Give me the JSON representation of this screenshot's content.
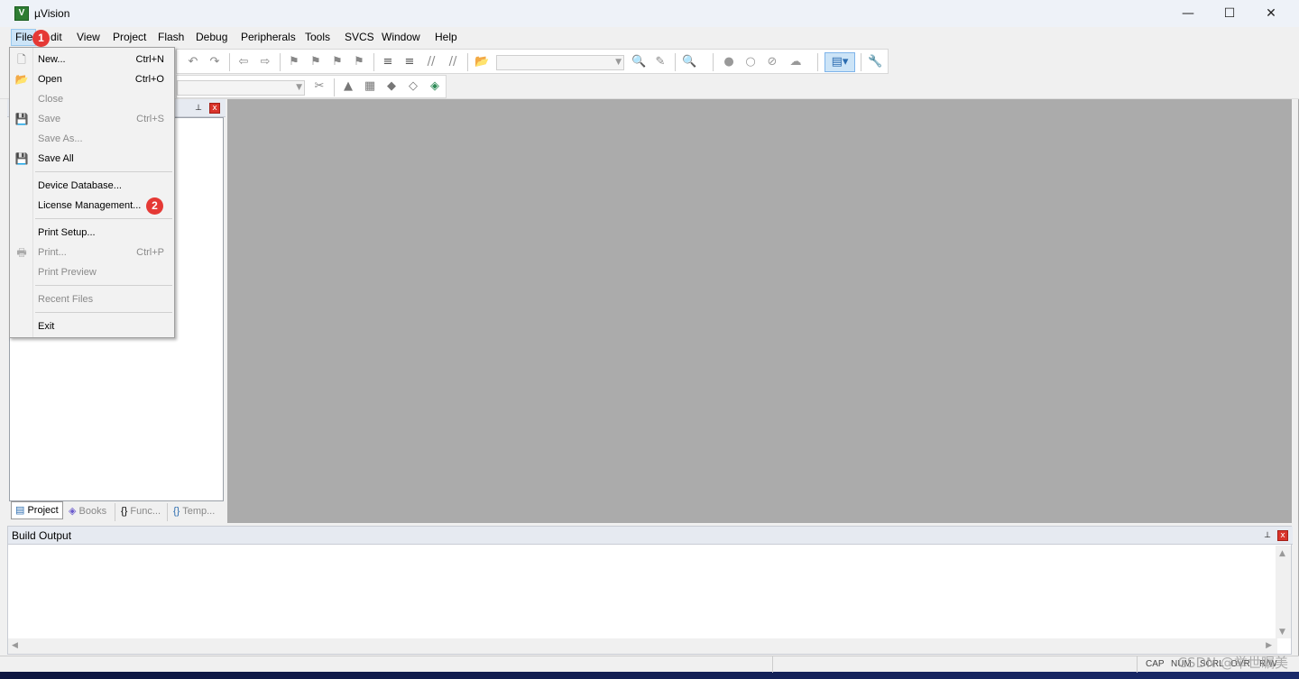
{
  "window": {
    "title": "µVision",
    "app_icon_glyph": "V",
    "controls": {
      "minimize": "—",
      "maximize": "☐",
      "close": "✕"
    }
  },
  "menubar": {
    "items": [
      "File",
      "Edit",
      "View",
      "Project",
      "Flash",
      "Debug",
      "Peripherals",
      "Tools",
      "SVCS",
      "Window",
      "Help"
    ],
    "file_menu_label": "File",
    "edit_menu_label_visible": "dit"
  },
  "annotations": {
    "badge1": "1",
    "badge2": "2"
  },
  "file_menu": {
    "new": {
      "label": "New...",
      "shortcut": "Ctrl+N",
      "enabled": true,
      "icon": "new-document-icon"
    },
    "open": {
      "label": "Open",
      "shortcut": "Ctrl+O",
      "enabled": true,
      "icon": "open-folder-icon"
    },
    "close": {
      "label": "Close",
      "shortcut": "",
      "enabled": false
    },
    "save": {
      "label": "Save",
      "shortcut": "Ctrl+S",
      "enabled": false,
      "icon": "save-icon"
    },
    "save_as": {
      "label": "Save As...",
      "shortcut": "",
      "enabled": false
    },
    "save_all": {
      "label": "Save All",
      "shortcut": "",
      "enabled": true,
      "icon": "save-all-icon"
    },
    "device_database": {
      "label": "Device Database...",
      "enabled": true
    },
    "license_management": {
      "label": "License Management...",
      "enabled": true
    },
    "print_setup": {
      "label": "Print Setup...",
      "enabled": true
    },
    "print": {
      "label": "Print...",
      "shortcut": "Ctrl+P",
      "enabled": false,
      "icon": "print-icon"
    },
    "print_preview": {
      "label": "Print Preview",
      "enabled": false
    },
    "recent_files": {
      "label": "Recent Files",
      "enabled": false
    },
    "exit": {
      "label": "Exit",
      "enabled": true
    }
  },
  "left_panel": {
    "tabs": [
      "Project",
      "Books",
      "Func...",
      "Temp..."
    ],
    "tab_icons": [
      "project-icon",
      "books-icon",
      "functions-icon",
      "templates-icon"
    ],
    "active_tab": "Project"
  },
  "build_output": {
    "title": "Build Output"
  },
  "status_bar": {
    "cap": "CAP",
    "num": "NUM",
    "scrl": "SCRL",
    "ovr": "OVR",
    "rw": "R/W"
  },
  "watermark": "CSDN @举世瞩美"
}
